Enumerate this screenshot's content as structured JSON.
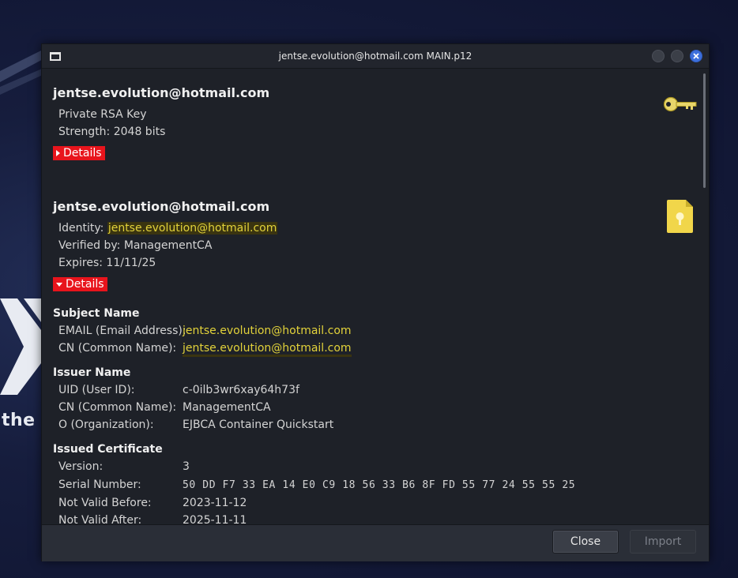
{
  "window": {
    "title": "jentse.evolution@hotmail.com MAIN.p12"
  },
  "desktop": {
    "partial_text": "the"
  },
  "key_section": {
    "name": "jentse.evolution@hotmail.com",
    "type": "Private RSA Key",
    "strength": "Strength: 2048 bits",
    "details_label": "Details",
    "icon": "key-icon"
  },
  "cert_section": {
    "name": "jentse.evolution@hotmail.com",
    "identity_label": "Identity: ",
    "identity_value": "jentse.evolution@hotmail.com",
    "verified_by": "Verified by: ManagementCA",
    "expires": "Expires: 11/11/25",
    "details_label": "Details",
    "icon": "certificate-icon"
  },
  "details": {
    "subject_name": {
      "heading": "Subject Name",
      "rows": [
        {
          "key": "EMAIL (Email Address):",
          "value": "jentse.evolution@hotmail.com"
        },
        {
          "key": "CN (Common Name):",
          "value": "jentse.evolution@hotmail.com"
        }
      ]
    },
    "issuer_name": {
      "heading": "Issuer Name",
      "rows": [
        {
          "key": "UID (User ID):",
          "value": "c-0ilb3wr6xay64h73f"
        },
        {
          "key": "CN (Common Name):",
          "value": "ManagementCA"
        },
        {
          "key": "O (Organization):",
          "value": "EJBCA Container Quickstart"
        }
      ]
    },
    "issued_certificate": {
      "heading": "Issued Certificate",
      "rows": [
        {
          "key": "Version:",
          "value": "3"
        },
        {
          "key": "Serial Number:",
          "value": "50 DD F7 33 EA 14 E0 C9 18 56 33 B6 8F FD 55 77 24 55 55 25"
        },
        {
          "key": "Not Valid Before:",
          "value": "2023-11-12"
        },
        {
          "key": "Not Valid After:",
          "value": "2025-11-11"
        }
      ]
    }
  },
  "footer": {
    "close_label": "Close",
    "import_label": "Import"
  },
  "colors": {
    "highlight_text": "#e2d23a",
    "details_button": "#e8141c",
    "close_button": "#3d6fdc"
  }
}
